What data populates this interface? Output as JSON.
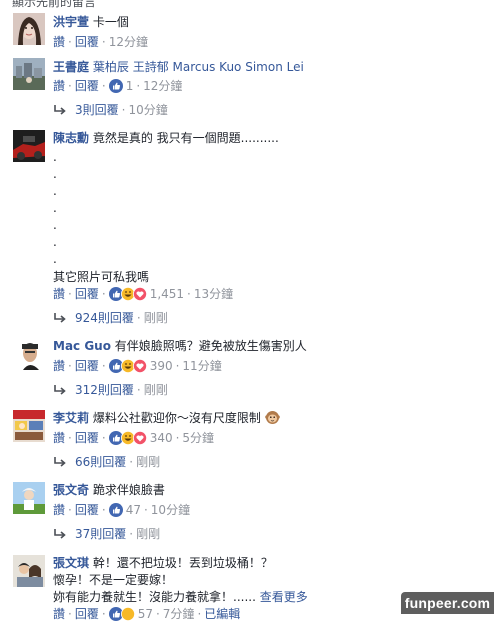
{
  "header": {
    "clipped_text": "顯示先前的留言"
  },
  "actions": {
    "like": "讚",
    "reply": "回覆",
    "separator": "·"
  },
  "comments": [
    {
      "name": "洪宇萱",
      "text": "卡一個",
      "time": "12分鐘"
    },
    {
      "name": "王書庭",
      "tags": [
        "葉柏辰",
        "王詩郁",
        "Marcus Kuo",
        "Simon Lei"
      ],
      "like_count": "1",
      "time": "12分鐘",
      "replies": {
        "label": "3則回覆",
        "time": "10分鐘"
      }
    },
    {
      "name": "陳志勳",
      "text": "竟然是真的 我只有一個問題..........",
      "dots": [
        ".",
        ".",
        ".",
        ".",
        ".",
        ".",
        "."
      ],
      "text2": "其它照片可私我嗎",
      "like_count": "1,451",
      "time": "13分鐘",
      "replies": {
        "label": "924則回覆",
        "time": "剛剛"
      }
    },
    {
      "name": "Mac Guo",
      "text": "有伴娘臉照嗎？避免被放生傷害別人",
      "like_count": "390",
      "time": "11分鐘",
      "replies": {
        "label": "312則回覆",
        "time": "剛剛"
      }
    },
    {
      "name": "李艾莉",
      "text": "爆料公社歡迎你～沒有尺度限制",
      "like_count": "340",
      "time": "5分鐘",
      "replies": {
        "label": "66則回覆",
        "time": "剛剛"
      }
    },
    {
      "name": "張文奇",
      "text": "跪求伴娘臉書",
      "like_count": "47",
      "time": "10分鐘",
      "replies": {
        "label": "37則回覆",
        "time": "剛剛"
      }
    },
    {
      "name": "張文琪",
      "text": "幹！還不把垃圾！丟到垃圾桶！？",
      "text2": "懷孕！不是一定要嫁！",
      "text3": "妳有能力養就生！沒能力養就拿！......",
      "see_more": "查看更多",
      "like_count": "57",
      "time": "7分鐘",
      "edited": "已編輯"
    }
  ],
  "watermark": "funpeer.com",
  "colors": {
    "link": "#365899",
    "meta": "#90949c",
    "text": "#1d2129",
    "like_blue": "#4267b2",
    "haha_yellow": "#f7b928",
    "love_red": "#f25268"
  }
}
